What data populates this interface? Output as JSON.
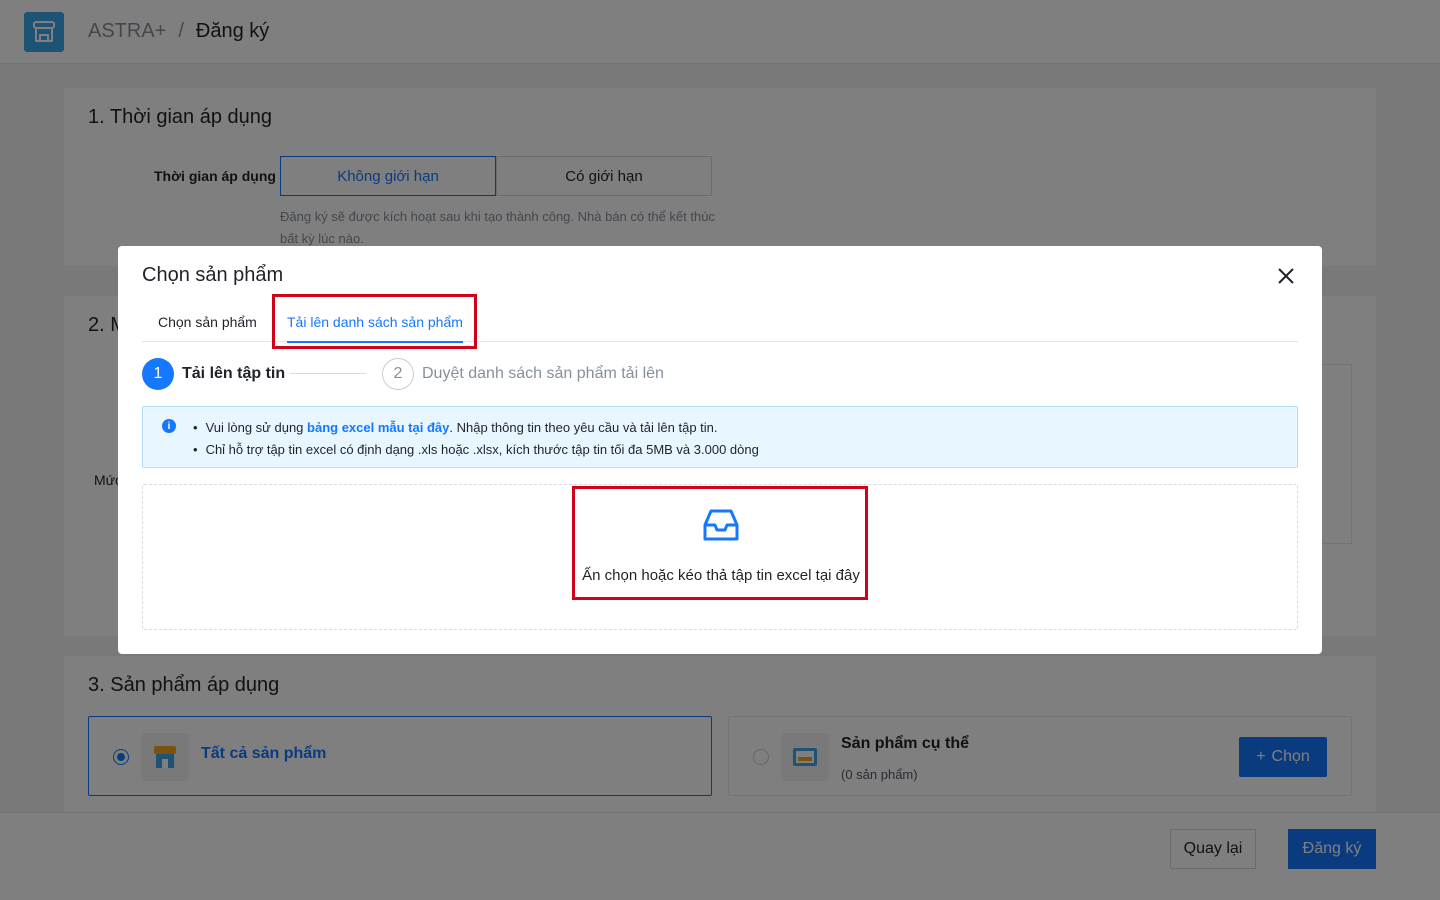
{
  "header": {
    "app_name": "ASTRA+",
    "separator": "/",
    "current_page": "Đăng ký"
  },
  "section1": {
    "title": "1. Thời gian áp dụng",
    "field_label": "Thời gian áp dụng",
    "options": [
      "Không giới hạn",
      "Có giới hạn"
    ],
    "selected": "Không giới hạn",
    "hint": "Đăng ký sẽ được kích hoạt sau khi tạo thành công. Nhà bán có thể kết thúc bất kỳ lúc nào."
  },
  "section2": {
    "title": "2. M",
    "label": "Mức"
  },
  "section3": {
    "title": "3. Sản phẩm áp dụng",
    "option_all": "Tất cả sản phẩm",
    "option_specific": "Sản phẩm cụ thể",
    "option_specific_count": "(0 sản phẩm)",
    "choose_button": "Chọn"
  },
  "footer": {
    "back_button": "Quay lại",
    "submit_button": "Đăng ký"
  },
  "modal": {
    "title": "Chọn sản phẩm",
    "tabs": [
      "Chọn sản phẩm",
      "Tải lên danh sách sản phẩm"
    ],
    "active_tab": "Tải lên danh sách sản phẩm",
    "steps": [
      {
        "number": "1",
        "label": "Tải lên tập tin"
      },
      {
        "number": "2",
        "label": "Duyệt danh sách sản phẩm tải lên"
      }
    ],
    "info": {
      "line1_prefix": "Vui lòng sử dụng ",
      "line1_link": "bảng excel mẫu tại đây",
      "line1_suffix": ". Nhập thông tin theo yêu cầu và tải lên tập tin.",
      "line2": "Chỉ hỗ trợ tập tin excel có định dạng .xls hoặc .xlsx, kích thước tập tin tối đa 5MB và 3.000 dòng"
    },
    "dropzone_text": "Ấn chọn hoặc kéo thả tập tin excel tại đây"
  },
  "colors": {
    "accent": "#1677ff",
    "highlight": "#d0011b",
    "logo": "#3aa7e8",
    "info_bg": "#e8f6ff"
  },
  "icons": {
    "logo": "store-icon",
    "close": "close-icon",
    "info": "info-icon",
    "dropzone": "inbox-icon"
  }
}
